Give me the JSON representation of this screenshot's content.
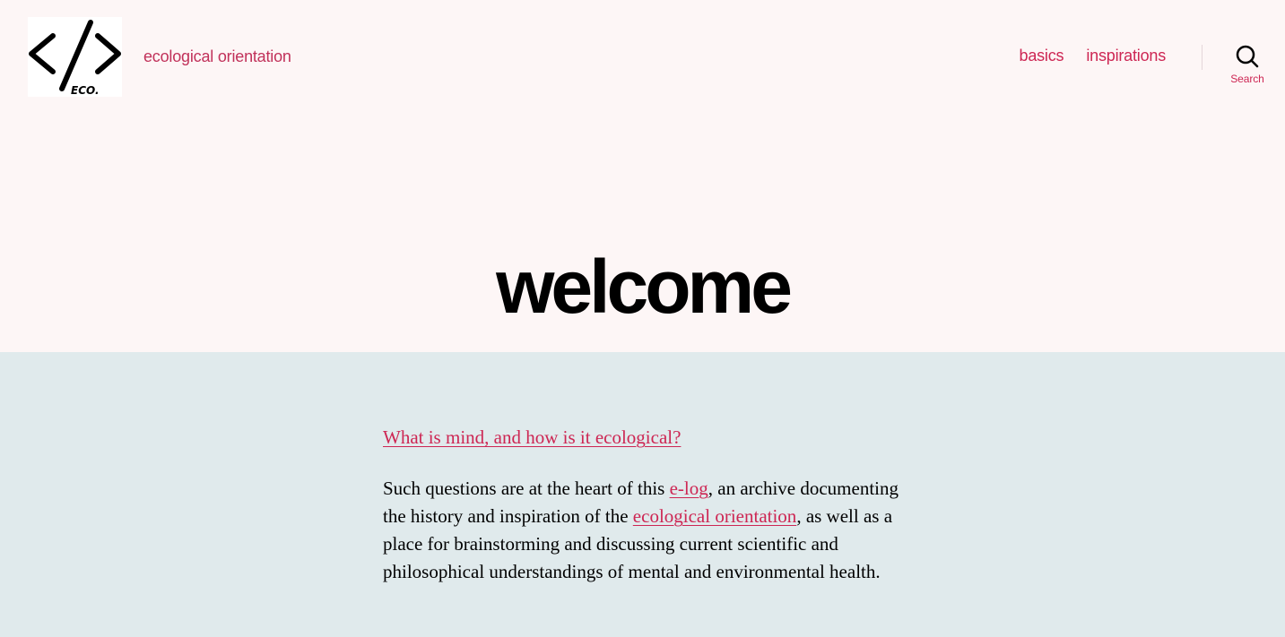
{
  "site": {
    "logo_text": "ECO.",
    "tagline": "ecological orientation"
  },
  "nav": {
    "items": [
      {
        "label": "basics"
      },
      {
        "label": "inspirations"
      }
    ]
  },
  "search": {
    "label": "Search"
  },
  "page": {
    "title": "welcome"
  },
  "content": {
    "heading_link": "What is mind, and how is it ecological?",
    "para": {
      "t1": "Such questions are at the heart of this ",
      "link1": "e-log",
      "t2": ", an archive documenting the history and inspiration of the ",
      "link2": "ecological orientation",
      "t3": ", as well as a place for brainstorming and discussing current scientific and philosophical understandings of mental and environmental health."
    }
  },
  "colors": {
    "accent": "#cd2653",
    "header_bg": "#fdf6f6",
    "content_bg": "#e0eaec"
  }
}
